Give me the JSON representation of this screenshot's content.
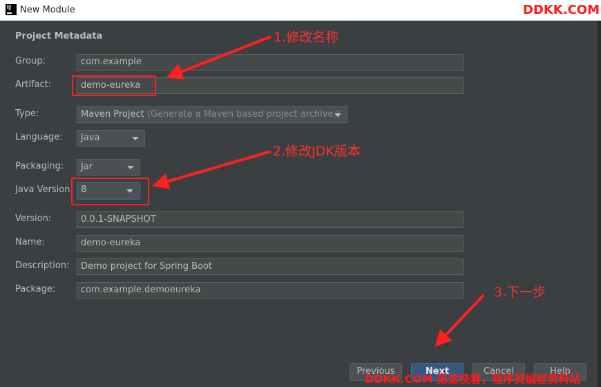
{
  "window": {
    "title": "New Module",
    "watermark_top": "DDKK.COM"
  },
  "section_title": "Project Metadata",
  "form": {
    "group": {
      "label": "Group:",
      "value": "com.example"
    },
    "artifact": {
      "label": "Artifact:",
      "value": "demo-eureka"
    },
    "type": {
      "label": "Type:",
      "value": "Maven Project",
      "hint": "(Generate a Maven based project archive.)"
    },
    "language": {
      "label": "Language:",
      "value": "Java"
    },
    "packaging": {
      "label": "Packaging:",
      "value": "Jar"
    },
    "java_version": {
      "label": "Java Version:",
      "value": "8"
    },
    "version": {
      "label": "Version:",
      "value": "0.0.1-SNAPSHOT"
    },
    "name": {
      "label": "Name:",
      "value": "demo-eureka"
    },
    "description": {
      "label": "Description:",
      "value": "Demo project for Spring Boot"
    },
    "package": {
      "label": "Package:",
      "value": "com.example.demoeureka"
    }
  },
  "annotations": {
    "step1": "1.修改名称",
    "step2": "2.修改JDK版本",
    "step3": "3.下一步"
  },
  "buttons": {
    "previous": "Previous",
    "next": "Next",
    "cancel": "Cancel",
    "help": "Help"
  },
  "watermark_bottom": "DDKK.COM 弟弟快看，程序员编程资料站",
  "colors": {
    "background": "#3c3f41",
    "annotation_red": "#ff2020",
    "focus_blue": "#3d6185",
    "default_button": "#365880"
  },
  "icons": {
    "app": "intellij-idea-icon",
    "dropdown": "chevron-down-icon"
  }
}
